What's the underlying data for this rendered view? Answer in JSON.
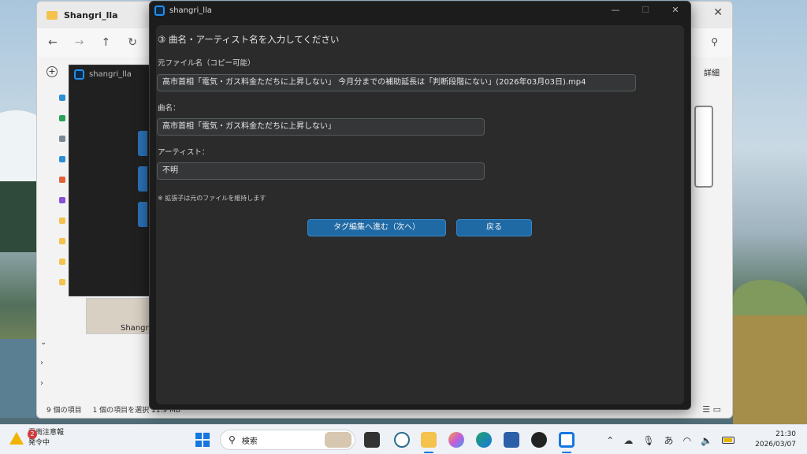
{
  "explorer": {
    "title": "Shangri_lla",
    "details_label": "詳細",
    "thumbnail_label": "Shangri_",
    "status": {
      "items_count": "9 個の項目",
      "selected": "1 個の項目を選択 11.9 MB"
    }
  },
  "secondary_window": {
    "title": "shangri_lla"
  },
  "main_window": {
    "title": "shangri_lla",
    "step_title": "③ 曲名・アーティスト名を入力してください",
    "original_filename_label": "元ファイル名（コピー可能）",
    "original_filename_value": "高市首相「電気・ガス料金ただちに上昇しない」 今月分までの補助延長は「判断段階にない」(2026年03月03日).mp4",
    "song_title_label": "曲名：",
    "song_title_value": "高市首相「電気・ガス料金ただちに上昇しない」",
    "artist_label": "アーティスト：",
    "artist_value": "不明",
    "note": "※ 拡張子は元のファイルを維持します",
    "next_button": "タグ編集へ進む（次へ）",
    "back_button": "戻る",
    "accent_color": "#1f6aa5"
  },
  "taskbar": {
    "weather_line1": "雷雨注意報",
    "weather_line2": "発令中",
    "weather_badge": "2",
    "search_placeholder": "検索",
    "ime_label": "あ",
    "time": "21:30",
    "date": "2026/03/07"
  }
}
